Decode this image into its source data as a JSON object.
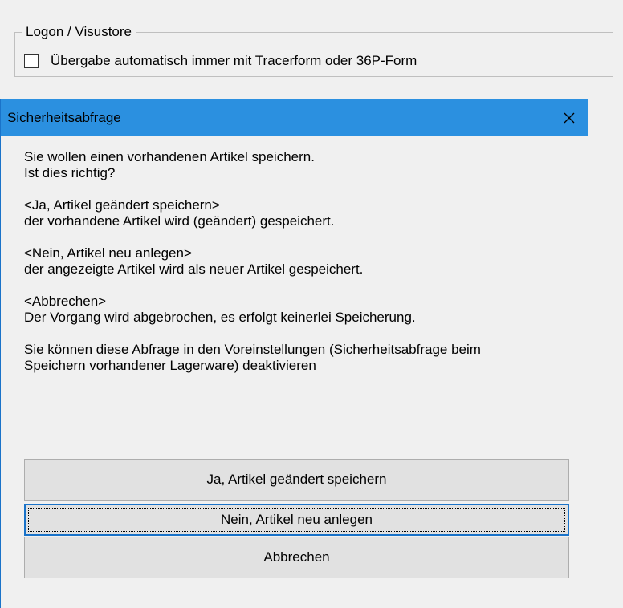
{
  "background_panel": {
    "group_title": "Logon / Visustore",
    "checkbox": {
      "label": "Übergabe automatisch immer mit Tracerform oder 36P-Form",
      "checked": false
    }
  },
  "dialog": {
    "title": "Sicherheitsabfrage",
    "close_icon": "close-icon",
    "message": {
      "p1_line1": "Sie wollen einen vorhandenen Artikel speichern.",
      "p1_line2": "Ist dies richtig?",
      "p2_line1": "<Ja, Artikel geändert speichern>",
      "p2_line2": "der vorhandene Artikel wird (geändert) gespeichert.",
      "p3_line1": "<Nein, Artikel neu anlegen>",
      "p3_line2": "der angezeigte Artikel wird als neuer Artikel gespeichert.",
      "p4_line1": "<Abbrechen>",
      "p4_line2": "Der Vorgang wird abgebrochen, es erfolgt keinerlei Speicherung.",
      "p5_line1": "Sie können diese Abfrage in den Voreinstellungen (Sicherheitsabfrage beim",
      "p5_line2": "Speichern vorhandener Lagerware) deaktivieren"
    },
    "buttons": {
      "yes_label": "Ja, Artikel geändert speichern",
      "no_label": "Nein, Artikel neu anlegen",
      "cancel_label": "Abbrechen"
    },
    "colors": {
      "titlebar": "#2b90e0",
      "focus_border": "#1a73c9"
    }
  }
}
